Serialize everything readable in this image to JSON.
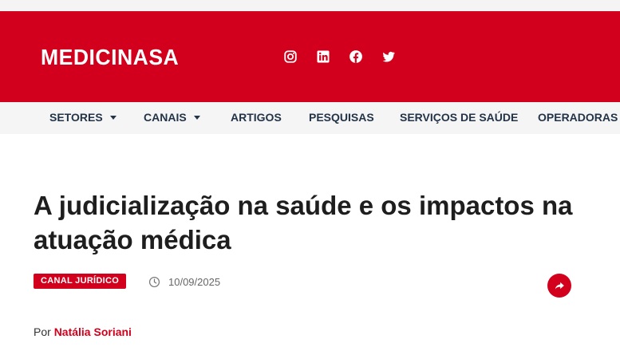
{
  "header": {
    "logo": "MEDICINASA",
    "social": [
      {
        "icon": "instagram-icon"
      },
      {
        "icon": "linkedin-icon"
      },
      {
        "icon": "facebook-icon"
      },
      {
        "icon": "twitter-icon"
      }
    ],
    "brand_color": "#d2001c"
  },
  "nav": {
    "items": [
      {
        "label": "SETORES",
        "dropdown": true
      },
      {
        "label": "CANAIS",
        "dropdown": true
      },
      {
        "label": "ARTIGOS",
        "dropdown": false
      },
      {
        "label": "PESQUISAS",
        "dropdown": false
      },
      {
        "label": "SERVIÇOS DE SAÚDE",
        "dropdown": false
      },
      {
        "label": "OPERADORAS",
        "dropdown": false
      }
    ]
  },
  "article": {
    "title": "A judicialização na saúde e os impactos na atuação médica",
    "category": "CANAL JURÍDICO",
    "date": "10/09/2025",
    "by_prefix": "Por",
    "author": "Natália Soriani"
  }
}
